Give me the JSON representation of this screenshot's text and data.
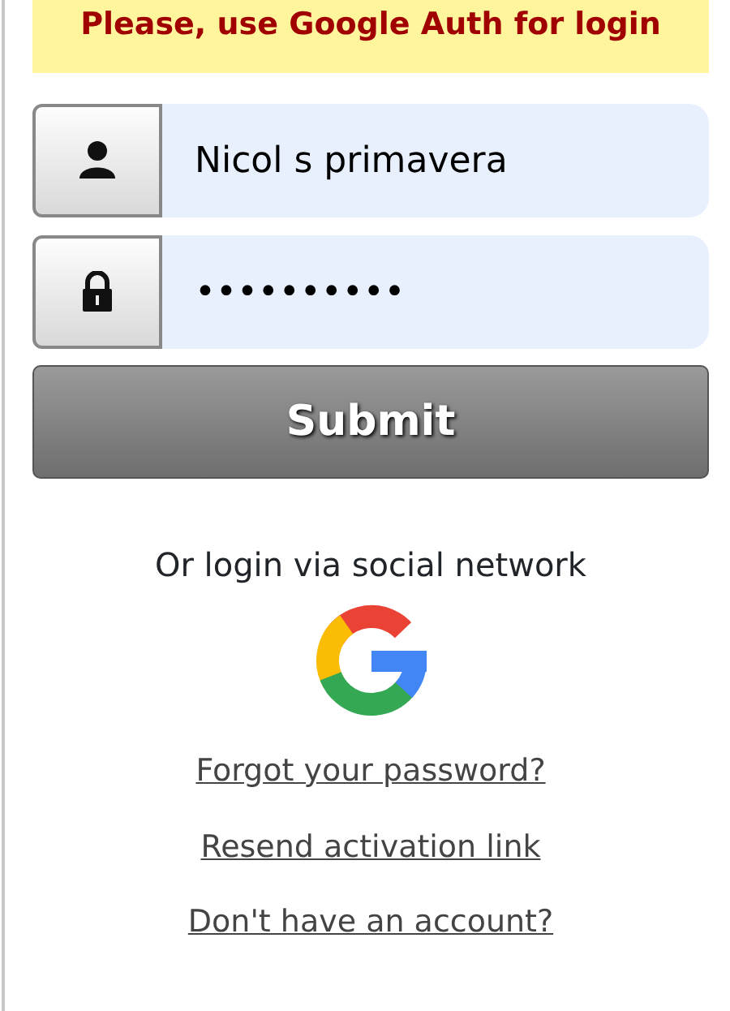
{
  "banner": {
    "text": "Please, use Google Auth for login"
  },
  "fields": [
    {
      "kind": "user",
      "value": "Nicol s primavera"
    },
    {
      "kind": "lock",
      "value": "••••••••••"
    }
  ],
  "submit": "Submit",
  "social": {
    "text": "Or login via social network"
  },
  "links": [
    "Forgot your password?",
    "Resend activation link",
    "Don't have an account?"
  ]
}
